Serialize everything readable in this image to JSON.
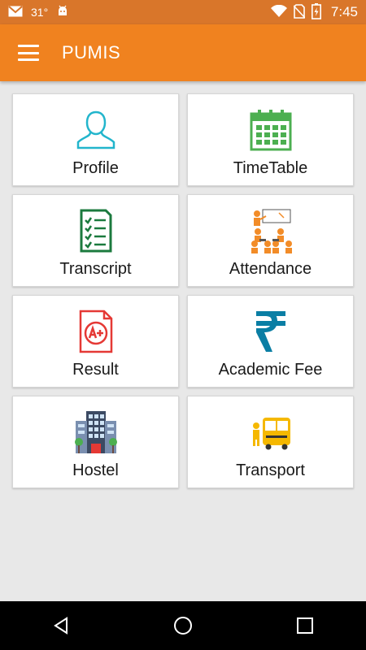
{
  "status_bar": {
    "temperature": "31°",
    "time": "7:45"
  },
  "app_bar": {
    "title": "PUMIS"
  },
  "tiles": [
    {
      "label": "Profile",
      "icon": "profile-icon"
    },
    {
      "label": "TimeTable",
      "icon": "calendar-icon"
    },
    {
      "label": "Transcript",
      "icon": "checklist-icon"
    },
    {
      "label": "Attendance",
      "icon": "classroom-icon"
    },
    {
      "label": "Result",
      "icon": "grade-a-plus-icon"
    },
    {
      "label": "Academic Fee",
      "icon": "rupee-icon"
    },
    {
      "label": "Hostel",
      "icon": "building-icon"
    },
    {
      "label": "Transport",
      "icon": "bus-icon"
    }
  ],
  "colors": {
    "status_bar": "#d9762a",
    "app_bar": "#f0821f",
    "profile": "#22b5cc",
    "timetable": "#4caf50",
    "transcript": "#1b7a3e",
    "attendance": "#f28c28",
    "result": "#e53935",
    "fee": "#0a7ea4",
    "transport": "#f5b800"
  }
}
